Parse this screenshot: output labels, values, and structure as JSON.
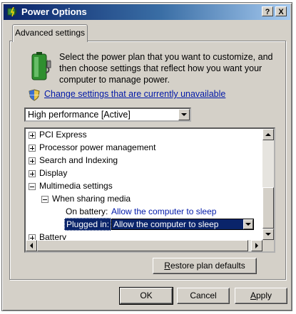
{
  "window": {
    "title": "Power Options",
    "help_button": "?",
    "close_button": "X",
    "tab_label": "Advanced settings"
  },
  "intro": {
    "text": "Select the power plan that you want to customize, and then choose settings that reflect how you want your computer to manage power.",
    "change_link": "Change settings that are currently unavailable"
  },
  "plan_select": {
    "value": "High performance [Active]"
  },
  "tree": {
    "items": [
      {
        "label": "PCI Express",
        "state": "collapsed"
      },
      {
        "label": "Processor power management",
        "state": "collapsed"
      },
      {
        "label": "Search and Indexing",
        "state": "collapsed"
      },
      {
        "label": "Display",
        "state": "collapsed"
      },
      {
        "label": "Multimedia settings",
        "state": "expanded"
      },
      {
        "label": "When sharing media",
        "state": "expanded"
      },
      {
        "label": "On battery:",
        "value": "Allow the computer to sleep"
      },
      {
        "label": "Plugged in:",
        "value": "Allow the computer to sleep"
      },
      {
        "label": "Battery",
        "state": "collapsed"
      }
    ]
  },
  "buttons": {
    "restore_first": "R",
    "restore_rest": "estore plan defaults",
    "ok": "OK",
    "cancel": "Cancel",
    "apply_first": "A",
    "apply_rest": "pply"
  },
  "colors": {
    "title_gradient_start": "#0a246a",
    "title_gradient_end": "#a6caf0",
    "dialog_face": "#d4d0c8",
    "link": "#0018a8",
    "selection": "#0a246a"
  },
  "icons": {
    "title": "power-options-icon",
    "battery": "battery-plug-icon",
    "shield": "uac-shield-icon"
  }
}
